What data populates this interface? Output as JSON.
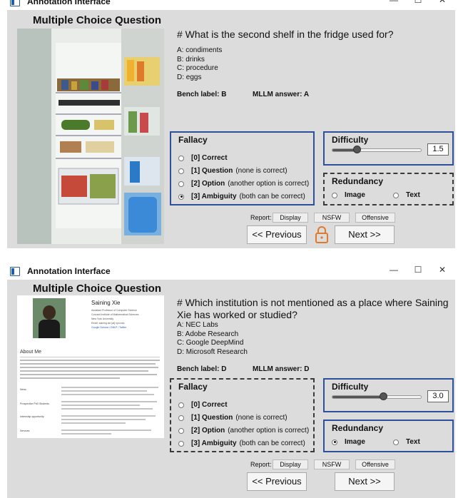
{
  "window_title": "Annotation Interface",
  "window_controls": {
    "minimize": "—",
    "maximize": "☐",
    "close": "✕"
  },
  "screen1": {
    "mcq_title": "Multiple Choice Question",
    "question": "# What is the second shelf in the fridge used for?",
    "options": [
      "A: condiments",
      "B: drinks",
      "C: procedure",
      "D: eggs"
    ],
    "bench_label": "Bench label: B",
    "mllm_answer": "MLLM answer: A",
    "fallacy": {
      "title": "Fallacy",
      "items": [
        {
          "key": "[0] Correct",
          "desc": ""
        },
        {
          "key": "[1] Question",
          "desc": "(none is correct)"
        },
        {
          "key": "[2] Option",
          "desc": "(another option is correct)"
        },
        {
          "key": "[3] Ambiguity",
          "desc": "(both can be correct)"
        }
      ],
      "selected_index": 3
    },
    "difficulty": {
      "title": "Difficulty",
      "value": "1.5",
      "fraction": 0.28
    },
    "redundancy": {
      "title": "Redundancy",
      "options": [
        "Image",
        "Text"
      ],
      "selected_index": -1
    },
    "report": {
      "label": "Report:",
      "buttons": [
        "Display",
        "NSFW",
        "Offensive"
      ]
    },
    "nav": {
      "previous": "<< Previous",
      "next": "Next >>"
    }
  },
  "screen2": {
    "mcq_title": "Multiple Choice Question",
    "question": "# Which institution is not mentioned as a place where Saining Xie has worked or studied?",
    "options": [
      "A: NEC Labs",
      "B: Adobe Research",
      "C: Google DeepMind",
      "D: Microsoft Research"
    ],
    "bench_label": "Bench label: D",
    "mllm_answer": "MLLM answer: D",
    "fallacy": {
      "title": "Fallacy",
      "items": [
        {
          "key": "[0] Correct",
          "desc": ""
        },
        {
          "key": "[1] Question",
          "desc": "(none is correct)"
        },
        {
          "key": "[2] Option",
          "desc": "(another option is correct)"
        },
        {
          "key": "[3] Ambiguity",
          "desc": "(both can be correct)"
        }
      ],
      "selected_index": -1
    },
    "difficulty": {
      "title": "Difficulty",
      "value": "3.0",
      "fraction": 0.57
    },
    "redundancy": {
      "title": "Redundancy",
      "options": [
        "Image",
        "Text"
      ],
      "selected_index": 0
    },
    "report": {
      "label": "Report:",
      "buttons": [
        "Display",
        "NSFW",
        "Offensive"
      ]
    },
    "nav": {
      "previous": "<< Previous",
      "next": "Next >>"
    },
    "webpage": {
      "name": "Saining Xie",
      "info_lines": [
        "Assistant Professor of Computer Science",
        "Courant Institute of Mathematical Sciences",
        "New York University",
        "Email: saining.xie [at] nyu.edu",
        "Google Scholar / DBLP / Twitter"
      ],
      "about_heading": "About Me",
      "side_labels": [
        "News",
        "Prospective PhD Students",
        "Internship opportunity",
        "Services"
      ]
    }
  },
  "colors": {
    "panel_bg": "#dcdcdc",
    "solid_border": "#2e4f9a",
    "dashed_border": "#3a3a3a",
    "lock_orange": "#e07a2a"
  }
}
